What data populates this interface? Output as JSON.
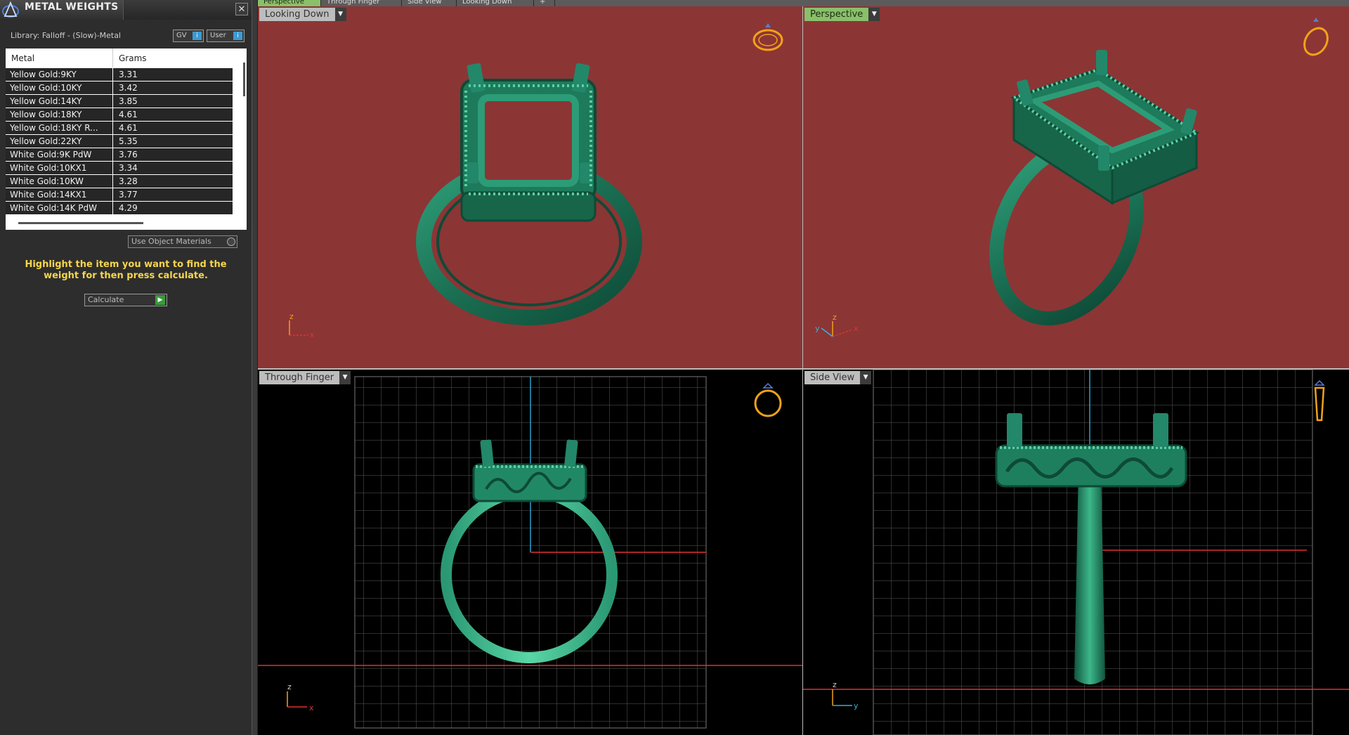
{
  "panel": {
    "title": "METAL WEIGHTS",
    "close_glyph": "✕",
    "library": "Library: Falloff - (Slow)-Metal",
    "toggles": {
      "gv": "GV",
      "user": "User",
      "knob": "i"
    },
    "table": {
      "headers": [
        "Metal",
        "Grams"
      ],
      "rows": [
        {
          "metal": "Yellow Gold:9KY",
          "grams": "3.31"
        },
        {
          "metal": "Yellow Gold:10KY",
          "grams": "3.42"
        },
        {
          "metal": "Yellow Gold:14KY",
          "grams": "3.85"
        },
        {
          "metal": "Yellow Gold:18KY",
          "grams": "4.61"
        },
        {
          "metal": "Yellow Gold:18KY R...",
          "grams": "4.61"
        },
        {
          "metal": "Yellow Gold:22KY",
          "grams": "5.35"
        },
        {
          "metal": "White Gold:9K PdW",
          "grams": "3.76"
        },
        {
          "metal": "White Gold:10KX1",
          "grams": "3.34"
        },
        {
          "metal": "White Gold:10KW",
          "grams": "3.28"
        },
        {
          "metal": "White Gold:14KX1",
          "grams": "3.77"
        },
        {
          "metal": "White Gold:14K PdW",
          "grams": "4.29"
        }
      ]
    },
    "use_materials": "Use Object Materials",
    "instructions": "Highlight the item you want to find the weight for then press calculate.",
    "calculate": "Calculate",
    "calc_arrow": "▶"
  },
  "top_tabs": [
    "Perspective",
    "Through Finger",
    "Side View",
    "Looking Down",
    "+"
  ],
  "viewports": {
    "top_left": {
      "label": "Looking Down",
      "axes": [
        "z",
        "x"
      ]
    },
    "top_right": {
      "label": "Perspective",
      "axes": [
        "z",
        "y",
        "x"
      ]
    },
    "bottom_left": {
      "label": "Through Finger",
      "axes": [
        "z",
        "x"
      ]
    },
    "bottom_right": {
      "label": "Side View",
      "axes": [
        "z",
        "y"
      ]
    },
    "dropdown_glyph": "▼"
  },
  "colors": {
    "viewport_red": "#8c3535",
    "ring_green": "#1f7a5a",
    "active_tab": "#8ac06a",
    "instruction_yellow": "#f6d64a",
    "gizmo_gold": "#f2a218"
  },
  "icons": [
    "app-logo-icon",
    "close-icon",
    "ring-gizmo-icon",
    "dropdown-icon",
    "play-icon"
  ]
}
